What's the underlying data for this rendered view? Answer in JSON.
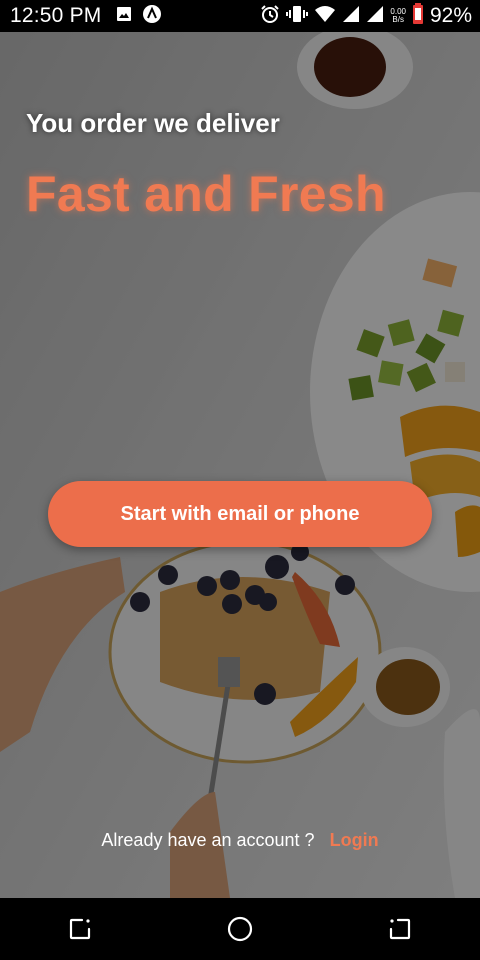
{
  "status_bar": {
    "time": "12:50 PM",
    "speed_value": "0.00",
    "speed_unit": "B/s",
    "battery": "92%",
    "icons": [
      "image-icon",
      "app-notification-icon",
      "alarm-icon",
      "vibrate-icon",
      "wifi-icon",
      "signal-icon",
      "signal-icon",
      "battery-icon"
    ]
  },
  "onboarding": {
    "tagline": "You order we deliver",
    "headline": "Fast and Fresh",
    "start_button_label": "Start with email or phone",
    "login_prompt": "Already have an account ?",
    "login_link": "Login"
  },
  "nav_bar": {
    "icons": [
      "recent-apps-icon",
      "home-icon",
      "back-icon"
    ]
  },
  "colors": {
    "accent": "#ec6e4b",
    "headline": "#f07a52"
  }
}
